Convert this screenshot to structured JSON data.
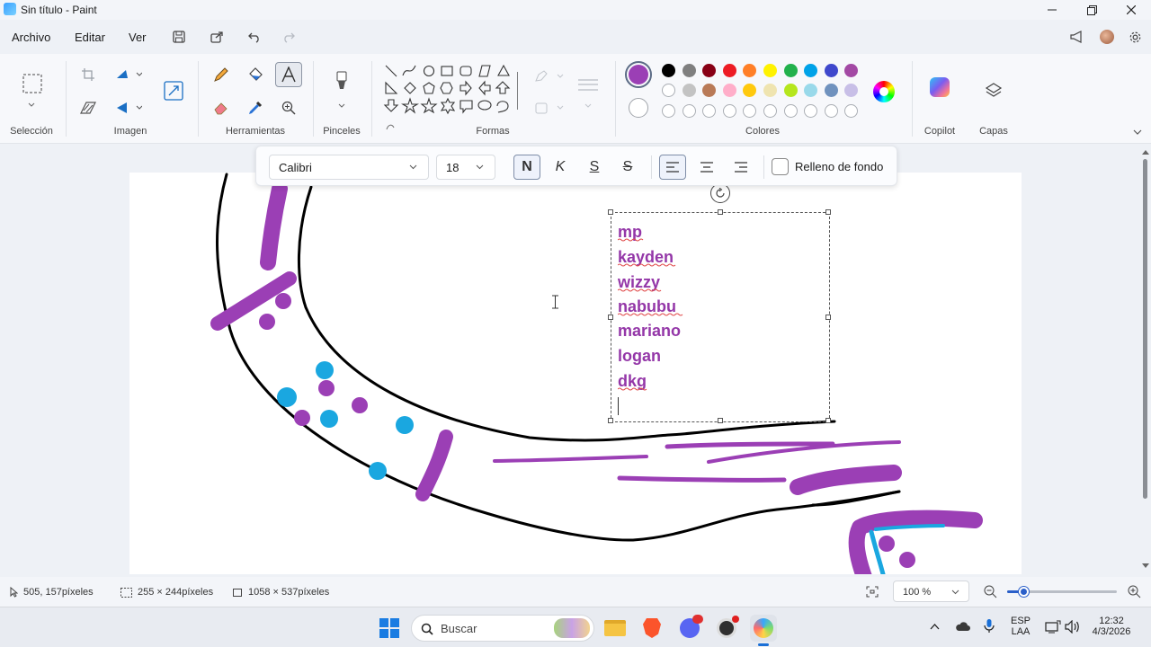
{
  "window": {
    "title": "Sin título - Paint",
    "minimize_icon": "minimize-icon",
    "maximize_icon": "restore-icon",
    "close_icon": "close-icon"
  },
  "menu": {
    "items": [
      "Archivo",
      "Editar",
      "Ver"
    ]
  },
  "ribbon": {
    "groups": {
      "seleccion": "Selección",
      "imagen": "Imagen",
      "herramientas": "Herramientas",
      "pinceles": "Pinceles",
      "formas": "Formas",
      "colores": "Colores",
      "copilot": "Copilot",
      "capas": "Capas"
    },
    "colors": {
      "primary": "#9b3fb5",
      "secondary": "#ffffff",
      "palette_row1": [
        "#000000",
        "#7f7f7f",
        "#880015",
        "#ed1c24",
        "#ff7f27",
        "#fff200",
        "#22b14c",
        "#00a2e8",
        "#3f48cc",
        "#a349a4"
      ],
      "palette_row2": [
        "#ffffff",
        "#c3c3c3",
        "#b97a57",
        "#ffaec9",
        "#ffc90e",
        "#efe4b0",
        "#b5e61d",
        "#99d9ea",
        "#7092be",
        "#c8bfe7"
      ]
    }
  },
  "text_toolbar": {
    "font": "Calibri",
    "size": "18",
    "bold": "N",
    "italic": "K",
    "underline": "S",
    "strikethrough": "S",
    "background_fill_label": "Relleno de fondo"
  },
  "canvas": {
    "text_lines": [
      "mp",
      "kayden",
      "wizzy",
      "nabubu",
      "mariano",
      "logan",
      "dkg"
    ],
    "text_color": "#9437a8",
    "stroke_colors": {
      "black": "#000000",
      "purple": "#9b3fb5",
      "blue": "#1aa7e0"
    }
  },
  "status": {
    "cursor_pos": "505, 157píxeles",
    "selection_size": "255 × 244píxeles",
    "canvas_size": "1058 × 537píxeles",
    "zoom": "100 %"
  },
  "taskbar": {
    "search_placeholder": "Buscar",
    "language": "ESP",
    "language_sub": "LAA",
    "time": "12:32",
    "date": "4/3/2026"
  }
}
